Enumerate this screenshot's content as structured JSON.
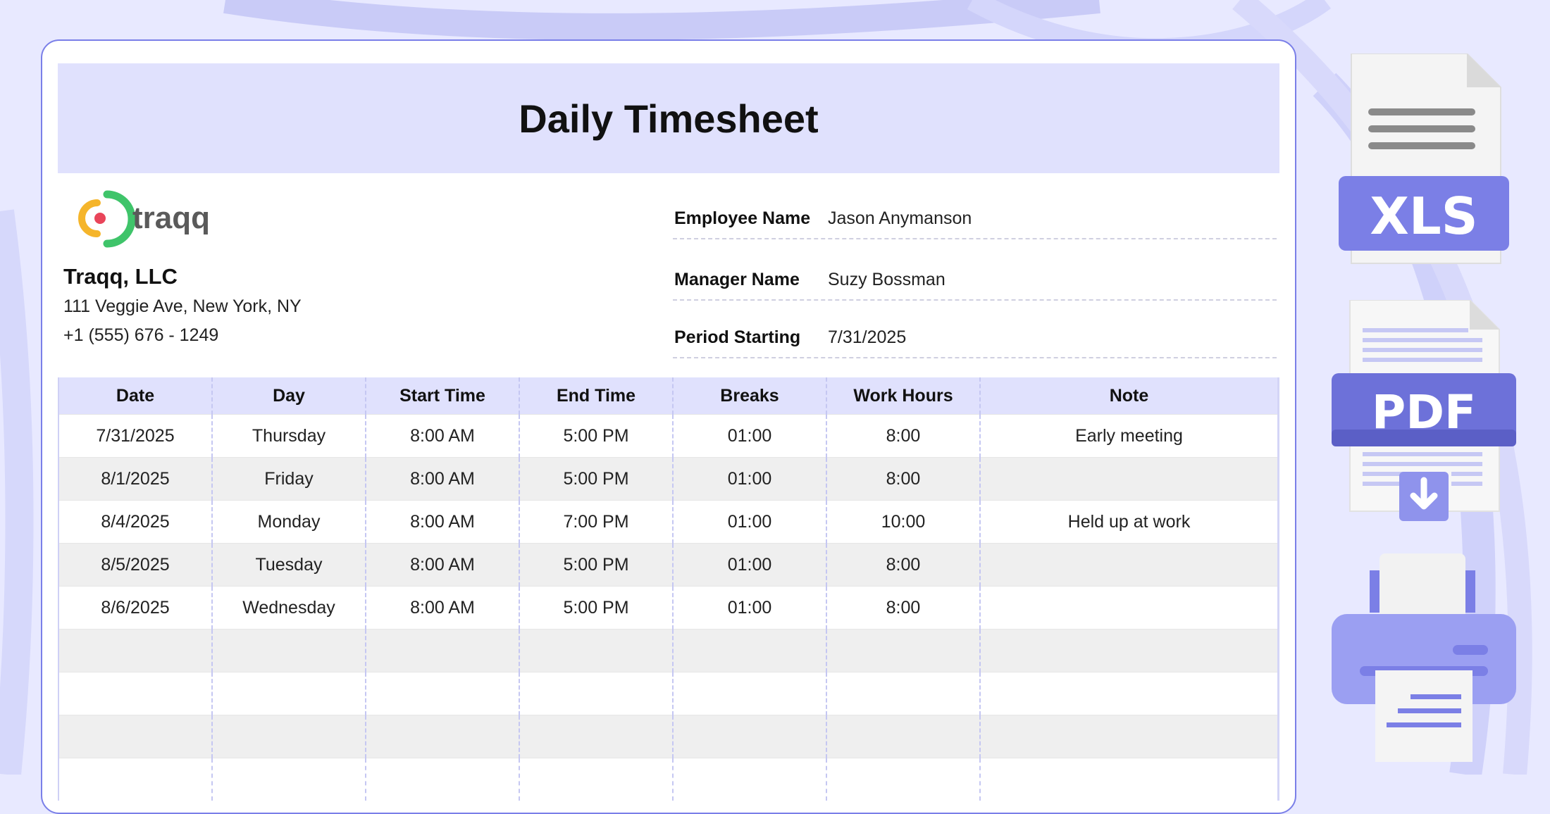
{
  "header": {
    "title": "Daily Timesheet"
  },
  "company": {
    "logo_text": "traqq",
    "name": "Traqq, LLC",
    "address": "111 Veggie Ave, New York, NY",
    "phone": "+1 (555) 676 - 1249"
  },
  "fields": {
    "employee": {
      "label": "Employee Name",
      "value": "Jason Anymanson"
    },
    "manager": {
      "label": "Manager Name",
      "value": "Suzy Bossman"
    },
    "period": {
      "label": "Period Starting",
      "value": "7/31/2025"
    }
  },
  "table": {
    "columns": [
      "Date",
      "Day",
      "Start Time",
      "End Time",
      "Breaks",
      "Work Hours",
      "Note"
    ],
    "rows": [
      [
        "7/31/2025",
        "Thursday",
        "8:00 AM",
        "5:00 PM",
        "01:00",
        "8:00",
        "Early meeting"
      ],
      [
        "8/1/2025",
        "Friday",
        "8:00 AM",
        "5:00 PM",
        "01:00",
        "8:00",
        ""
      ],
      [
        "8/4/2025",
        "Monday",
        "8:00 AM",
        "7:00 PM",
        "01:00",
        "10:00",
        "Held up at work"
      ],
      [
        "8/5/2025",
        "Tuesday",
        "8:00 AM",
        "5:00 PM",
        "01:00",
        "8:00",
        ""
      ],
      [
        "8/6/2025",
        "Wednesday",
        "8:00 AM",
        "5:00 PM",
        "01:00",
        "8:00",
        ""
      ],
      [
        "",
        "",
        "",
        "",
        "",
        "",
        ""
      ],
      [
        "",
        "",
        "",
        "",
        "",
        "",
        ""
      ],
      [
        "",
        "",
        "",
        "",
        "",
        "",
        ""
      ],
      [
        "",
        "",
        "",
        "",
        "",
        "",
        ""
      ]
    ]
  },
  "exports": {
    "xls_label": "XLS",
    "pdf_label": "PDF",
    "xls_icon": "xls-file-icon",
    "pdf_icon": "pdf-download-icon",
    "print_icon": "printer-icon"
  },
  "colors": {
    "accent": "#7b7fe6",
    "band": "#e0e1fd",
    "background": "#e8e9ff",
    "logo_green": "#3fc46a",
    "logo_orange": "#f5b52b",
    "logo_red": "#e9455a"
  }
}
